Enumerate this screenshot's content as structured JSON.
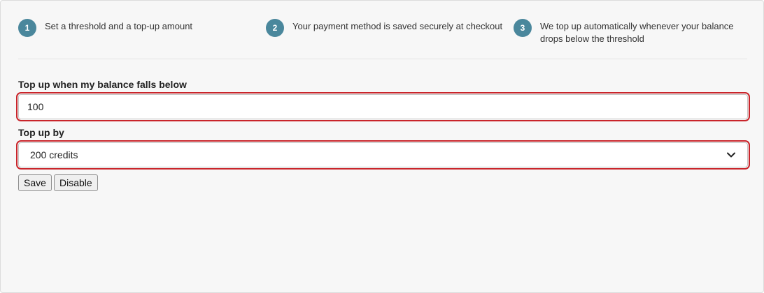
{
  "steps": [
    {
      "number": "1",
      "text": "Set a threshold and a top-up amount"
    },
    {
      "number": "2",
      "text": "Your payment method is saved securely at checkout"
    },
    {
      "number": "3",
      "text": "We top up automatically whenever your balance drops below the threshold"
    }
  ],
  "form": {
    "threshold_label": "Top up when my balance falls below",
    "threshold_value": "100",
    "topup_label": "Top up by",
    "topup_selected": "200 credits",
    "save_label": "Save",
    "disable_label": "Disable"
  },
  "colors": {
    "step_badge": "#4a879c",
    "highlight": "#c9252b",
    "panel_bg": "#f7f7f7"
  },
  "icons": {
    "select_arrow": "chevron-down-icon"
  }
}
